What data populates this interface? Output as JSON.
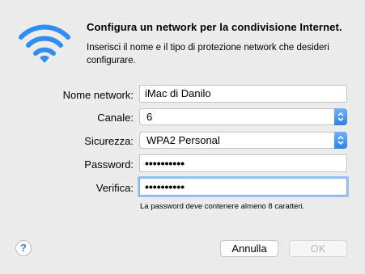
{
  "dialog": {
    "title": "Configura un network per la condivisione Internet.",
    "subtitle": "Inserisci il nome e il tipo di protezione network che desideri configurare."
  },
  "form": {
    "network_name": {
      "label": "Nome network:",
      "value": "iMac di Danilo"
    },
    "channel": {
      "label": "Canale:",
      "value": "6"
    },
    "security": {
      "label": "Sicurezza:",
      "value": "WPA2 Personal"
    },
    "password": {
      "label": "Password:",
      "masked_value": "••••••••••"
    },
    "verify": {
      "label": "Verifica:",
      "masked_value": "••••••••••"
    },
    "hint": "La password deve contenere almeno 8 caratteri."
  },
  "buttons": {
    "help": "?",
    "cancel": "Annulla",
    "ok": "OK"
  },
  "colors": {
    "wifi": "#2f8ef2",
    "accent": "#2f7fe9",
    "focus_ring": "#9ec3f0"
  },
  "icons": {
    "header": "wifi-icon",
    "select": "up-down-arrows-icon",
    "help": "help-icon"
  }
}
